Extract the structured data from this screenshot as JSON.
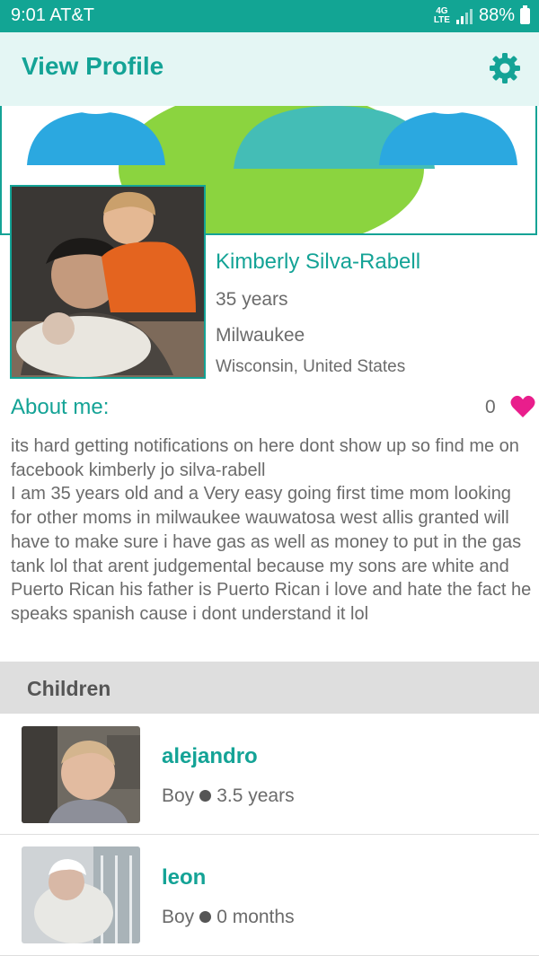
{
  "status_bar": {
    "time_carrier": "9:01 AT&T",
    "network": "4G LTE",
    "battery": "88%"
  },
  "app_bar": {
    "title": "View Profile",
    "settings_icon": "gear-icon"
  },
  "profile": {
    "name": "Kimberly Silva-Rabell",
    "age": "35 years",
    "city": "Milwaukee",
    "region": "Wisconsin, United States"
  },
  "about": {
    "label": "About me:",
    "likes": "0",
    "text": "its hard getting notifications on here dont show up so find me on facebook kimberly jo silva-rabell\nI am 35 years old and a Very easy going first time mom looking for other moms in milwaukee wauwatosa west allis granted will have to make sure i have gas as well as money to put in the gas tank lol that arent judgemental because my sons are white and Puerto Rican his father is Puerto Rican i love and hate the fact he speaks spanish cause i dont understand it lol"
  },
  "children": {
    "title": "Children",
    "items": [
      {
        "name": "alejandro",
        "gender": "Boy",
        "age": "3.5 years"
      },
      {
        "name": "leon",
        "gender": "Boy",
        "age": "0 months"
      }
    ]
  },
  "colors": {
    "accent": "#14a396",
    "status_bar": "#12a594",
    "heart": "#e91e8c"
  }
}
